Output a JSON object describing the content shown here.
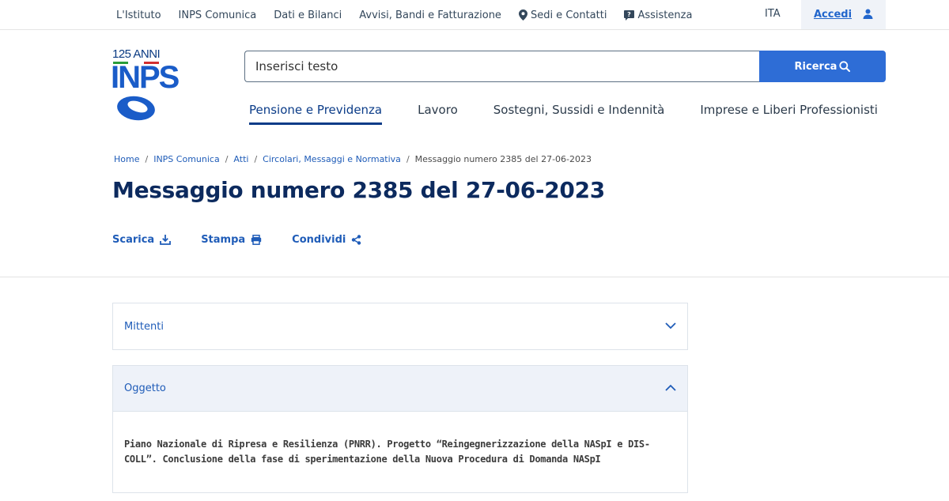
{
  "topbar": {
    "items": [
      {
        "label": "L'Istituto"
      },
      {
        "label": "INPS Comunica"
      },
      {
        "label": "Dati e Bilanci"
      },
      {
        "label": "Avvisi, Bandi e Fatturazione"
      },
      {
        "label": "Sedi e Contatti",
        "icon": "map-pin-icon"
      },
      {
        "label": "Assistenza",
        "icon": "help-chat-icon"
      }
    ],
    "language": "ITA",
    "login_label": "Accedi"
  },
  "logo": {
    "anni": "125 ANNI",
    "name": "INPS"
  },
  "search": {
    "placeholder": "Inserisci testo",
    "button_label": "Ricerca"
  },
  "mainnav": {
    "items": [
      {
        "label": "Pensione e Previdenza",
        "active": true
      },
      {
        "label": "Lavoro"
      },
      {
        "label": "Sostegni, Sussidi e Indennità"
      },
      {
        "label": "Imprese e Liberi Professionisti"
      }
    ]
  },
  "breadcrumb": {
    "items": [
      "Home",
      "INPS Comunica",
      "Atti",
      "Circolari, Messaggi e Normativa"
    ],
    "current": "Messaggio numero 2385 del 27-06-2023"
  },
  "page": {
    "title": "Messaggio numero 2385 del 27-06-2023",
    "actions": [
      {
        "label": "Scarica",
        "icon": "download-icon"
      },
      {
        "label": "Stampa",
        "icon": "print-icon"
      },
      {
        "label": "Condividi",
        "icon": "share-icon"
      }
    ]
  },
  "accordion": [
    {
      "title": "Mittenti",
      "expanded": false
    },
    {
      "title": "Oggetto",
      "expanded": true,
      "body_line1": "Piano Nazionale di Ripresa e Resilienza (PNRR). Progetto “Reingegnerizzazione della NASpI e DIS-",
      "body_line2": "COLL”. Conclusione della fase di sperimentazione della Nuova Procedura di Domanda NASpI"
    }
  ],
  "colors": {
    "brand_blue": "#1a5cc8",
    "navy": "#0c2a5e",
    "link_blue": "#1f5cb8",
    "button_blue": "#2e6dd6",
    "flag_green": "#2a9d3a",
    "flag_red": "#d32f2f"
  }
}
